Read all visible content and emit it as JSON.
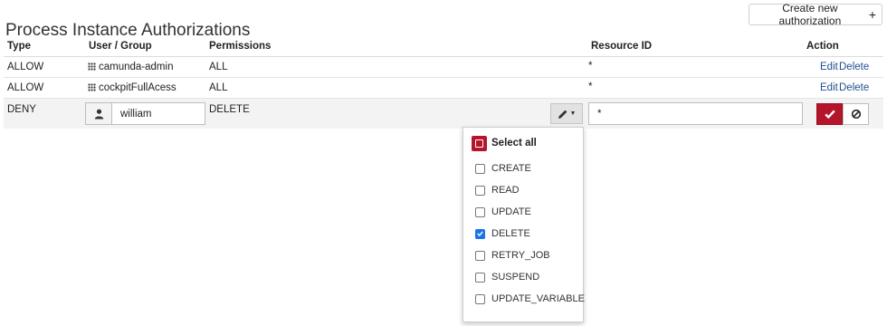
{
  "page": {
    "title": "Process Instance Authorizations",
    "create_button": "Create new authorization",
    "create_icon": "plus-icon"
  },
  "table": {
    "headers": {
      "type": "Type",
      "user_group": "User / Group",
      "permissions": "Permissions",
      "resource_id": "Resource ID",
      "action": "Action"
    },
    "rows": [
      {
        "type": "ALLOW",
        "user_group": "camunda-admin",
        "group_icon": "group-grid-icon",
        "permissions": "ALL",
        "resource_id": "*",
        "edit": "Edit",
        "delete": "Delete"
      },
      {
        "type": "ALLOW",
        "user_group": "cockpitFullAcess",
        "group_icon": "group-grid-icon",
        "permissions": "ALL",
        "resource_id": "*",
        "edit": "Edit",
        "delete": "Delete"
      }
    ],
    "edit_row": {
      "type": "DENY",
      "user_icon": "user-icon",
      "user_value": "william",
      "permissions": "DELETE",
      "resource_value": "*",
      "submit_icon": "checkmark-icon",
      "cancel_icon": "ban-icon"
    }
  },
  "permissions_dropdown": {
    "select_all": "Select all",
    "options": [
      {
        "label": "CREATE",
        "checked": false
      },
      {
        "label": "READ",
        "checked": false
      },
      {
        "label": "UPDATE",
        "checked": false
      },
      {
        "label": "DELETE",
        "checked": true
      },
      {
        "label": "RETRY_JOB",
        "checked": false
      },
      {
        "label": "SUSPEND",
        "checked": false
      },
      {
        "label": "UPDATE_VARIABLE",
        "checked": false
      }
    ]
  },
  "colors": {
    "accent_red": "#b5152b",
    "link_blue": "#1f4f8f",
    "check_blue": "#1a73e8"
  }
}
